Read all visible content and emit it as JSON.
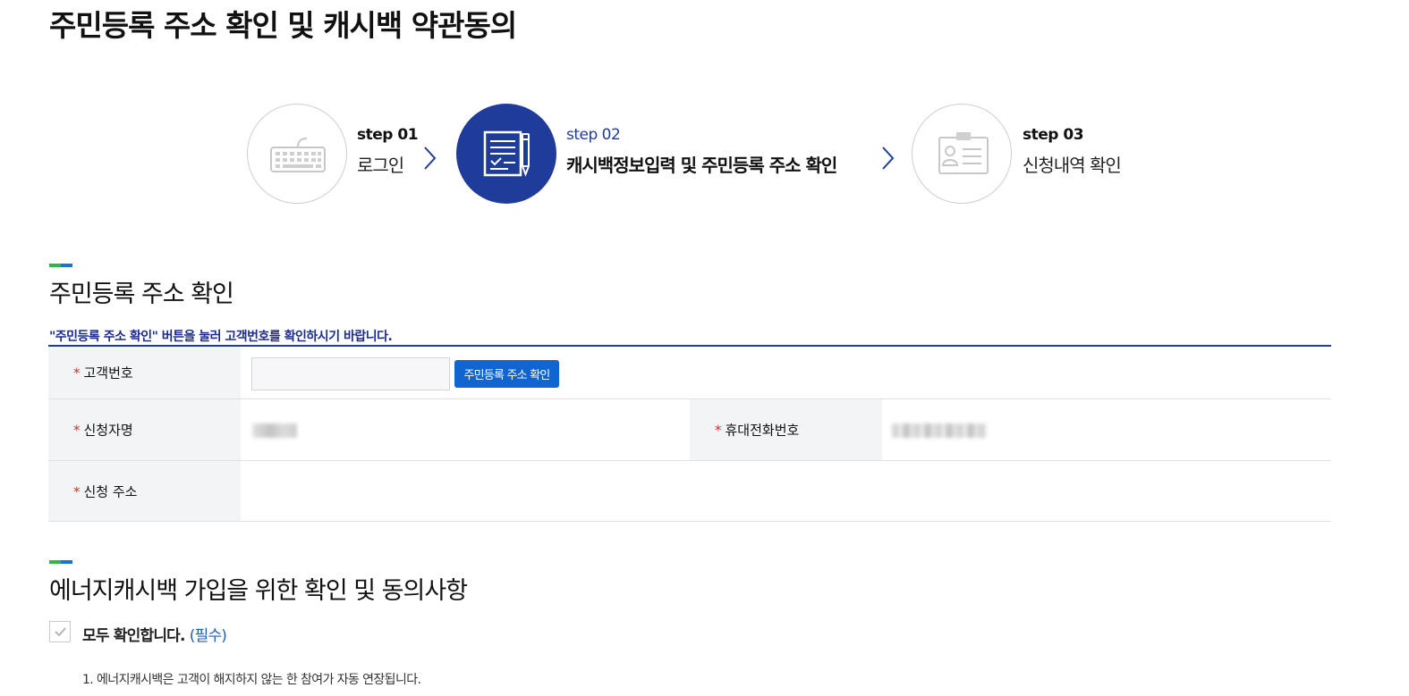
{
  "page": {
    "title": "주민등록 주소 확인 및 캐시백 약관동의"
  },
  "steps": [
    {
      "num": "step 01",
      "label": "로그인",
      "icon": "keyboard-icon",
      "active": false
    },
    {
      "num": "step 02",
      "label": "캐시백정보입력 및 주민등록 주소 확인",
      "icon": "document-pen-icon",
      "active": true
    },
    {
      "num": "step 03",
      "label": "신청내역 확인",
      "icon": "id-card-icon",
      "active": false
    }
  ],
  "address_section": {
    "title": "주민등록 주소 확인",
    "notice": "\"주민등록 주소 확인\" 버튼을 눌러 고객번호를 확인하시기 바랍니다.",
    "required_mark": "*",
    "customer_number_label": "고객번호",
    "customer_number_value": "",
    "verify_button": "주민등록 주소 확인",
    "applicant_name_label": "신청자명",
    "phone_label": "휴대전화번호",
    "address_label": "신청 주소"
  },
  "agreement_section": {
    "title": "에너지캐시백 가입을 위한 확인 및 동의사항",
    "agree_all_label": "모두 확인합니다.",
    "agree_all_required": "(필수)",
    "agree_all_checked": true,
    "terms": [
      "1. 에너지캐시백은 고객이 해지하지 않는 한 참여가 자동 연장됩니다."
    ]
  },
  "colors": {
    "primary": "#1f3c9b",
    "button": "#1065d1",
    "notice": "#1c2c8c",
    "required": "#d92c2c",
    "accent_green": "#35b34a",
    "accent_blue": "#1d74c8"
  }
}
